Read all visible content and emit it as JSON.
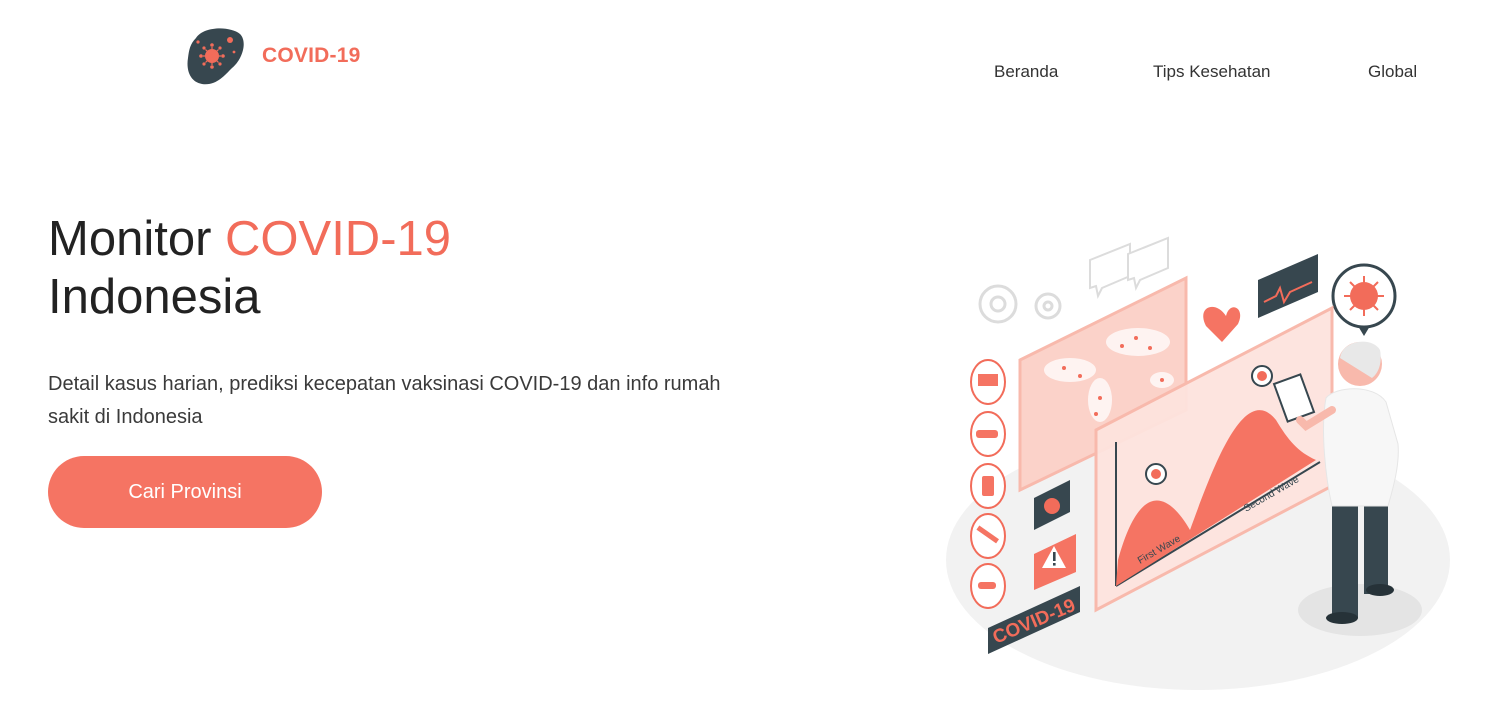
{
  "header": {
    "logo_text": "COVID-19",
    "logo_icon": "virus-blob-icon",
    "nav": [
      {
        "label": "Beranda"
      },
      {
        "label": "Tips Kesehatan"
      },
      {
        "label": "Global"
      }
    ]
  },
  "hero": {
    "title_prefix": "Monitor",
    "title_accent": "COVID-19",
    "title_suffix": "Indonesia",
    "description": "Detail kasus harian, prediksi kecepatan vaksinasi COVID-19 dan info rumah sakit di Indonesia",
    "cta_label": "Cari Provinsi"
  },
  "illustration": {
    "badge_text": "COVID-19",
    "first_wave_label": "First Wave",
    "second_wave_label": "Second Wave"
  },
  "colors": {
    "accent": "#f26c5a",
    "button": "#f57463",
    "dark": "#37474f"
  }
}
